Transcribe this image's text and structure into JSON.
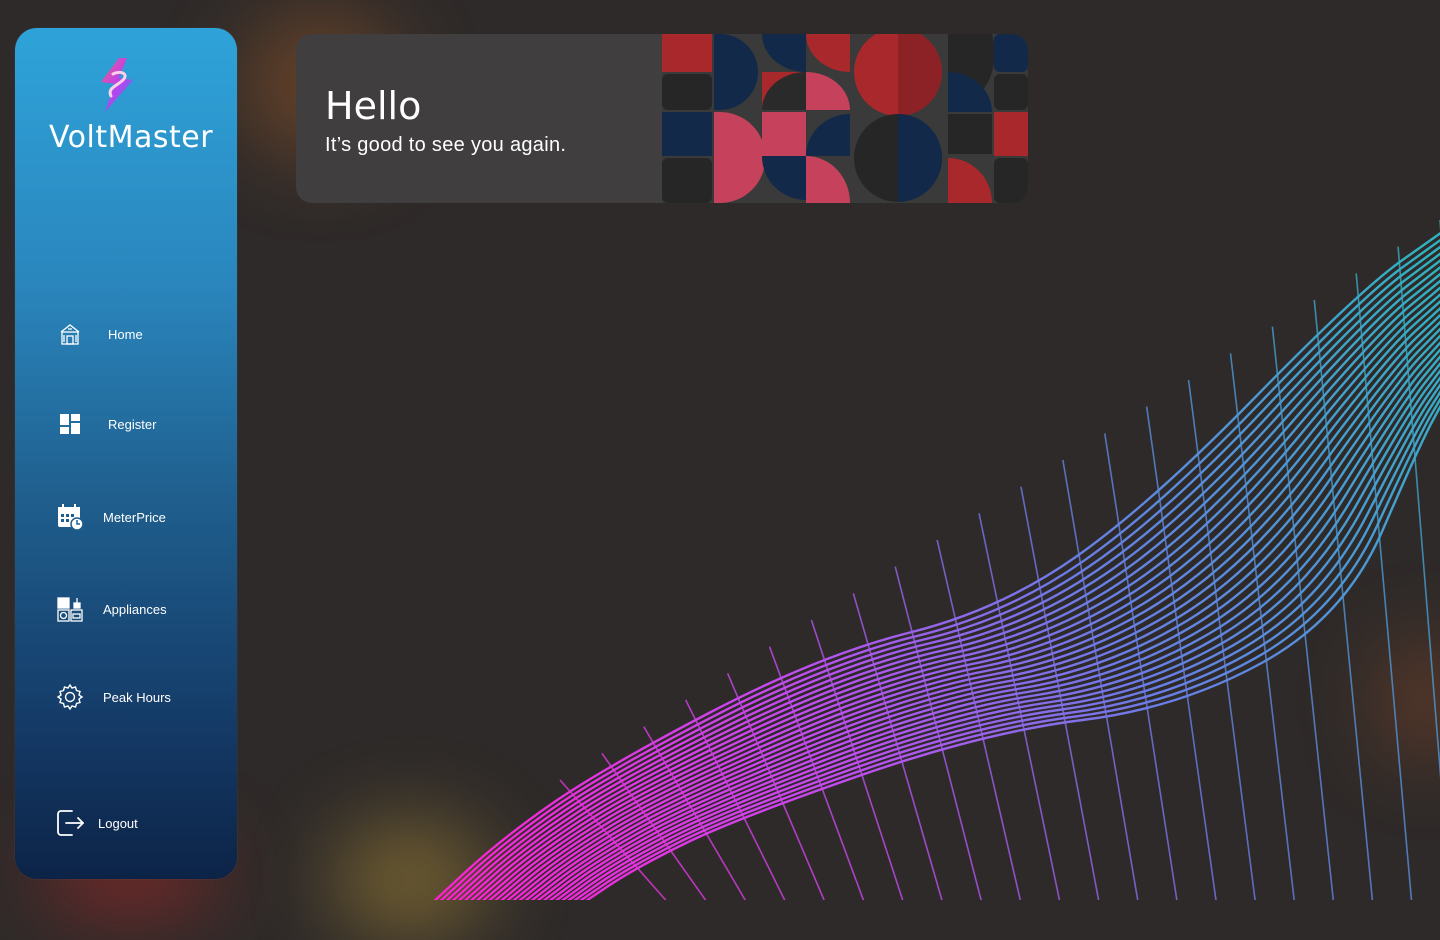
{
  "brand": {
    "name": "VoltMaster"
  },
  "sidebar": {
    "items": [
      {
        "label": "Home",
        "icon": "home-icon"
      },
      {
        "label": "Register",
        "icon": "grid-icon"
      },
      {
        "label": "MeterPrice",
        "icon": "calendar-clock-icon"
      },
      {
        "label": "Appliances",
        "icon": "appliances-icon"
      },
      {
        "label": "Peak Hours",
        "icon": "gear-icon"
      }
    ],
    "logout": {
      "label": "Logout",
      "icon": "logout-icon"
    }
  },
  "greeting": {
    "title": "Hello",
    "subtitle": "It’s good to see you again."
  },
  "colors": {
    "background": "#2e2a29",
    "sidebar_top": "#2ea3d9",
    "sidebar_bottom": "#0c2347",
    "card": "#403e3e",
    "wave_magenta": "#ff1fd0",
    "wave_teal": "#2fb3c0",
    "pattern_red": "#a8282c",
    "pattern_navy": "#12294a",
    "pattern_pink": "#c6425c",
    "pattern_dark": "#262626"
  }
}
